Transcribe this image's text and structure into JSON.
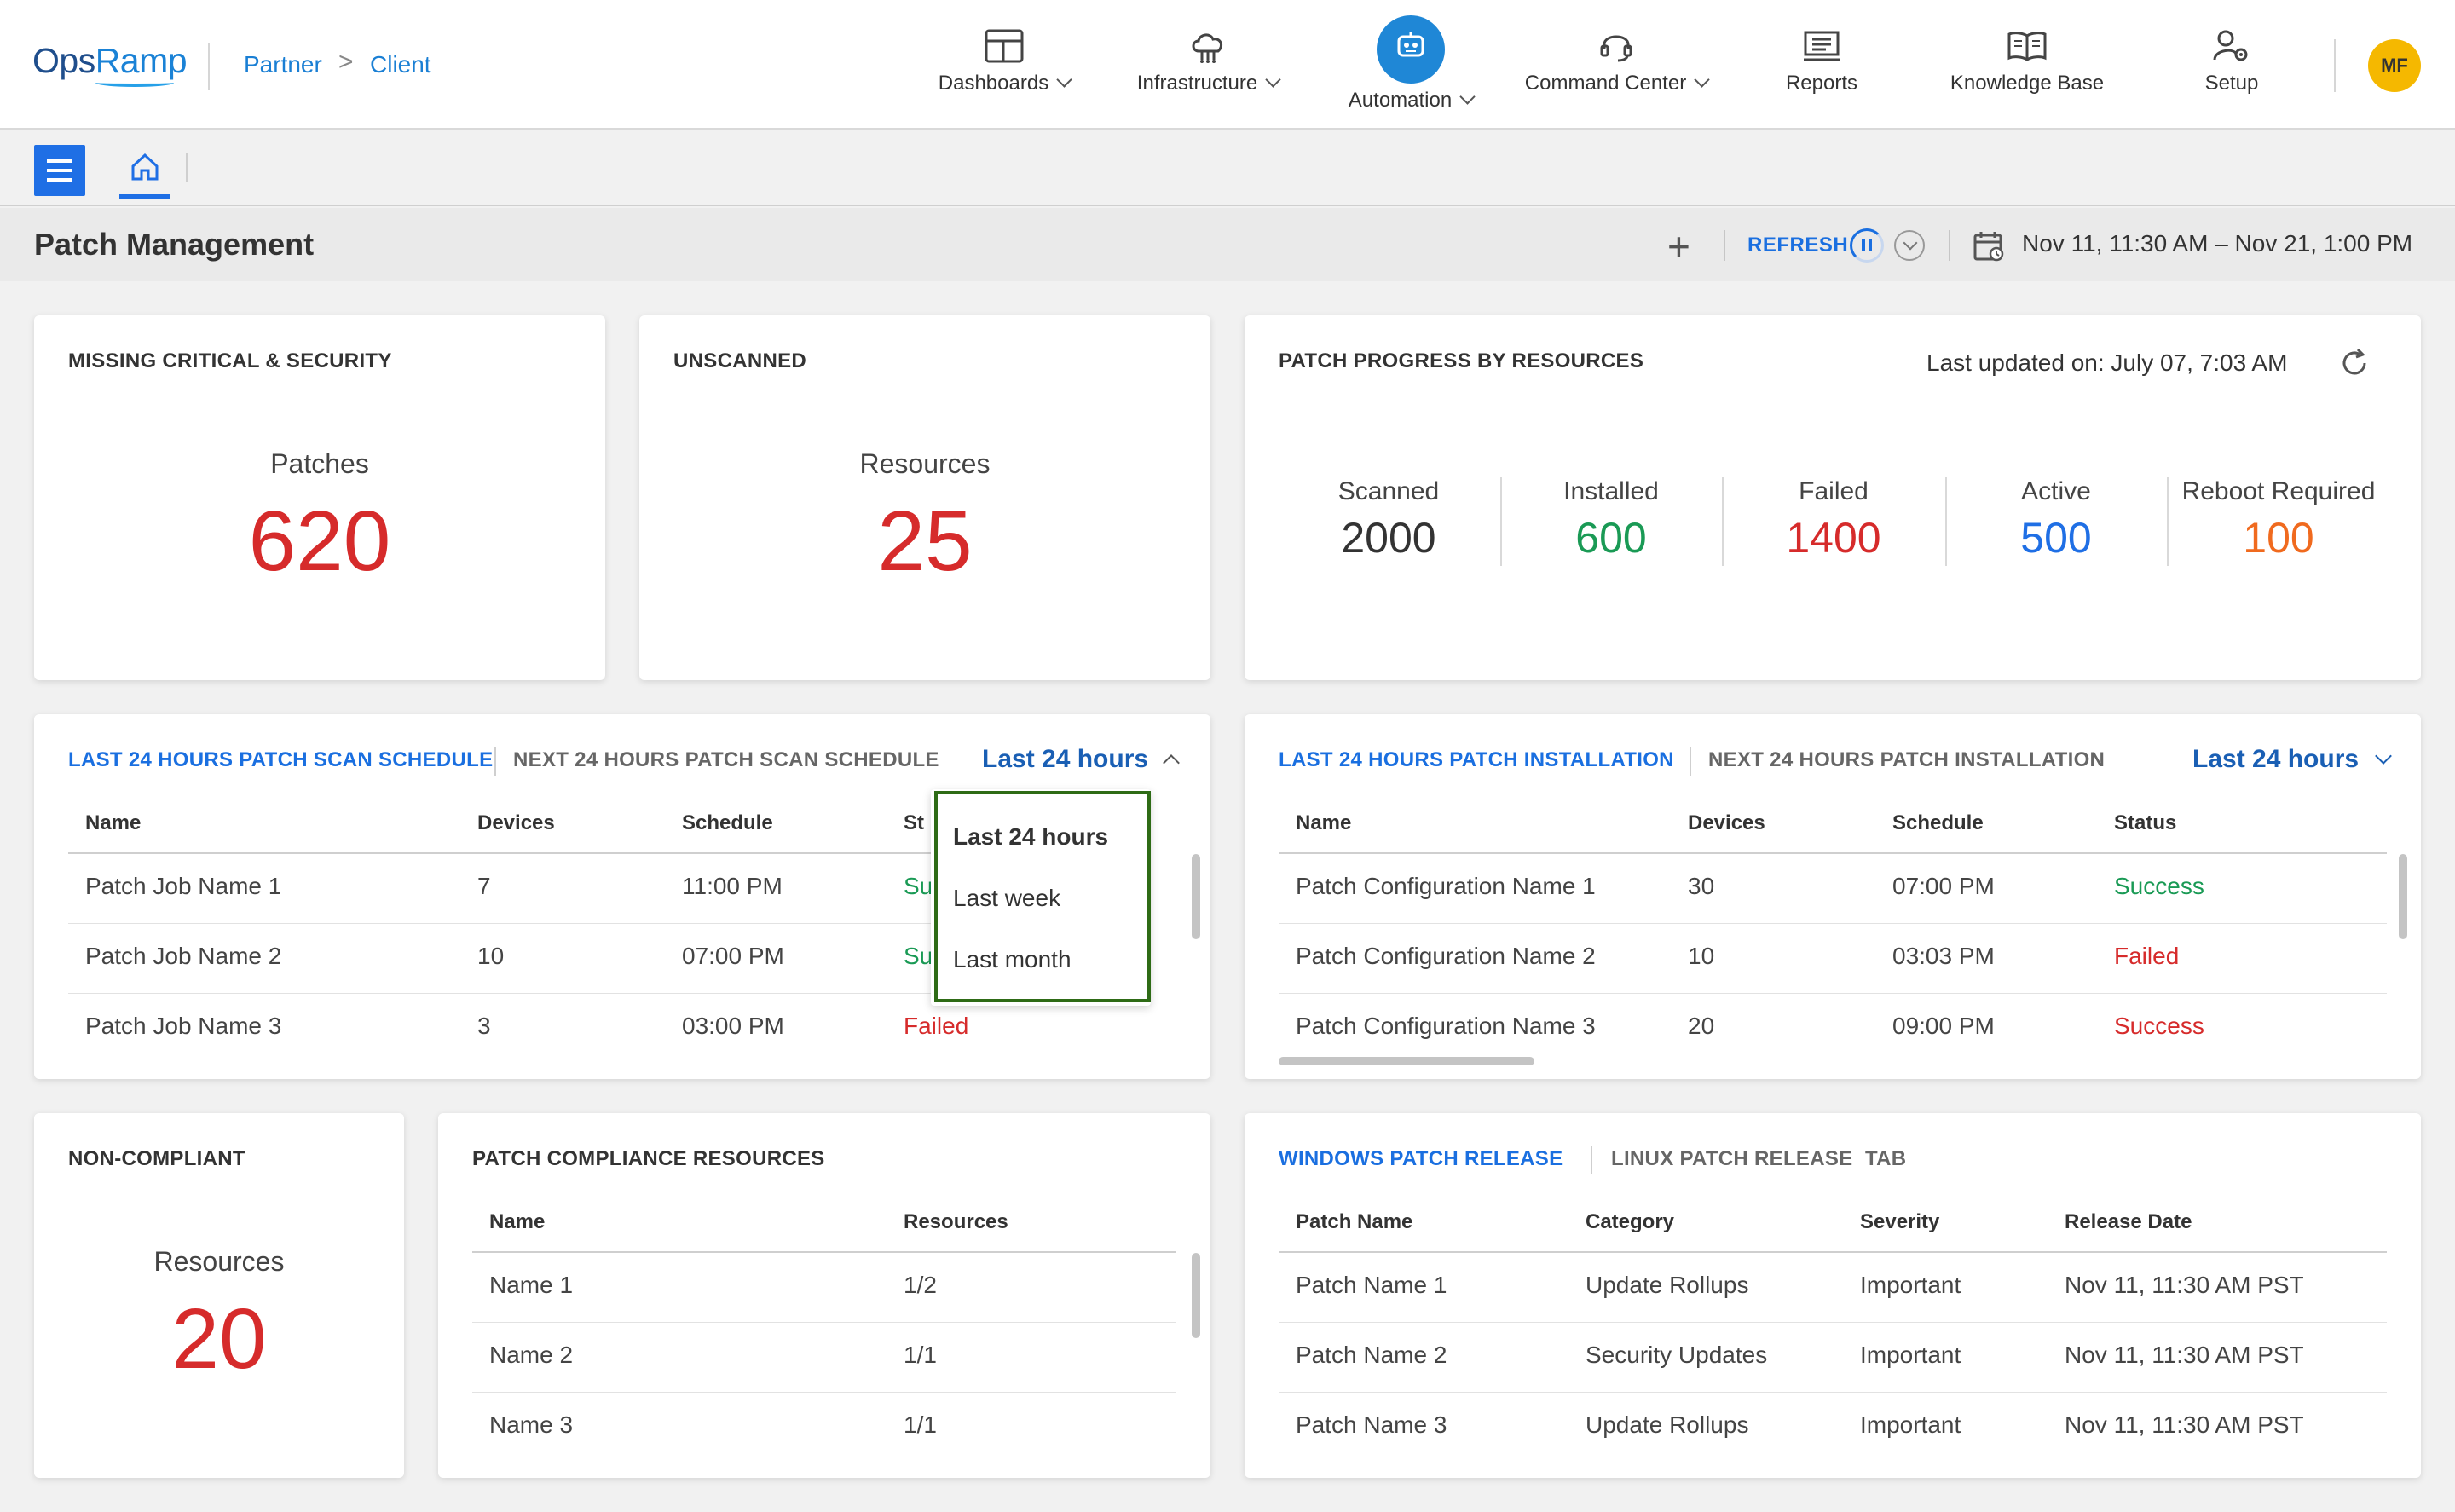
{
  "header": {
    "logo_part1": "Ops",
    "logo_part2": "Ramp",
    "breadcrumb": [
      "Partner",
      "Client"
    ],
    "breadcrumb_sep": ">",
    "nav": [
      {
        "label": "Dashboards",
        "icon": "dashboard-icon",
        "has_dropdown": true
      },
      {
        "label": "Infrastructure",
        "icon": "cloud-network-icon",
        "has_dropdown": true
      },
      {
        "label": "Automation",
        "icon": "robot-icon",
        "has_dropdown": true,
        "active": true
      },
      {
        "label": "Command Center",
        "icon": "headset-icon",
        "has_dropdown": true
      },
      {
        "label": "Reports",
        "icon": "reports-icon",
        "has_dropdown": false
      },
      {
        "label": "Knowledge Base",
        "icon": "book-icon",
        "has_dropdown": false
      },
      {
        "label": "Setup",
        "icon": "user-gear-icon",
        "has_dropdown": false
      }
    ],
    "avatar_initials": "MF"
  },
  "page": {
    "title": "Patch Management",
    "refresh_label": "REFRESH",
    "plus_label": "+",
    "date_range": "Nov 11, 11:30 AM – Nov 21, 1:00 PM"
  },
  "missing_card": {
    "title": "MISSING CRITICAL & SECURITY",
    "label": "Patches",
    "value": "620"
  },
  "unscanned_card": {
    "title": "UNSCANNED",
    "label": "Resources",
    "value": "25"
  },
  "progress_card": {
    "title": "PATCH PROGRESS BY RESOURCES",
    "last_updated": "Last updated on: July 07, 7:03 AM",
    "stats": [
      {
        "label": "Scanned",
        "value": "2000",
        "color": "#333333"
      },
      {
        "label": "Installed",
        "value": "600",
        "color": "#1a9a55"
      },
      {
        "label": "Failed",
        "value": "1400",
        "color": "#d62b2b"
      },
      {
        "label": "Active",
        "value": "500",
        "color": "#1f6fe5"
      },
      {
        "label": "Reboot Required",
        "value": "100",
        "color": "#f06a1e"
      }
    ]
  },
  "scan_card": {
    "tab_active": "LAST 24 HOURS PATCH SCAN SCHEDULE",
    "tab_inactive": "NEXT 24 HOURS PATCH SCAN SCHEDULE",
    "range": "Last 24 hours",
    "columns": [
      "Name",
      "Devices",
      "Schedule",
      "St"
    ],
    "rows": [
      {
        "name": "Patch Job Name 1",
        "devices": "7",
        "schedule": "11:00 PM",
        "status": "Su"
      },
      {
        "name": "Patch Job Name 2",
        "devices": "10",
        "schedule": "07:00 PM",
        "status": "Su"
      },
      {
        "name": "Patch Job Name 3",
        "devices": "3",
        "schedule": "03:00 PM",
        "status": "Failed"
      }
    ],
    "dropdown_options": [
      "Last 24 hours",
      "Last week",
      "Last month"
    ]
  },
  "install_card": {
    "tab_active": "LAST 24 HOURS PATCH INSTALLATION",
    "tab_inactive": "NEXT 24 HOURS PATCH INSTALLATION",
    "range": "Last 24 hours",
    "columns": [
      "Name",
      "Devices",
      "Schedule",
      "Status"
    ],
    "rows": [
      {
        "name": "Patch Configuration Name 1",
        "devices": "30",
        "schedule": "07:00 PM",
        "status": "Success"
      },
      {
        "name": "Patch Configuration Name 2",
        "devices": "10",
        "schedule": "03:03 PM",
        "status": "Failed"
      },
      {
        "name": "Patch Configuration Name 3",
        "devices": "20",
        "schedule": "09:00 PM",
        "status": "Success"
      }
    ]
  },
  "noncompliant_card": {
    "title": "NON-COMPLIANT",
    "label": "Resources",
    "value": "20"
  },
  "compliance_card": {
    "title": "PATCH COMPLIANCE RESOURCES",
    "columns": [
      "Name",
      "Resources"
    ],
    "rows": [
      {
        "name": "Name 1",
        "resources": "1/2"
      },
      {
        "name": "Name 2",
        "resources": "1/1"
      },
      {
        "name": "Name 3",
        "resources": "1/1"
      }
    ]
  },
  "release_card": {
    "tab_active": "WINDOWS PATCH RELEASE",
    "tab_inactive": "LINUX PATCH RELEASE",
    "tab_extra": "TAB",
    "columns": [
      "Patch Name",
      "Category",
      "Severity",
      "Release Date"
    ],
    "rows": [
      {
        "name": "Patch Name 1",
        "category": "Update Rollups",
        "severity": "Important",
        "date": "Nov 11, 11:30 AM PST"
      },
      {
        "name": "Patch Name 2",
        "category": "Security Updates",
        "severity": "Important",
        "date": "Nov 11, 11:30 AM PST"
      },
      {
        "name": "Patch Name 3",
        "category": "Update Rollups",
        "severity": "Important",
        "date": "Nov 11, 11:30 AM PST"
      }
    ]
  },
  "colors": {
    "accent": "#1f6fe5",
    "success": "#1a9a55",
    "failed": "#d62b2b",
    "highlight_frame": "#2e6b16"
  }
}
